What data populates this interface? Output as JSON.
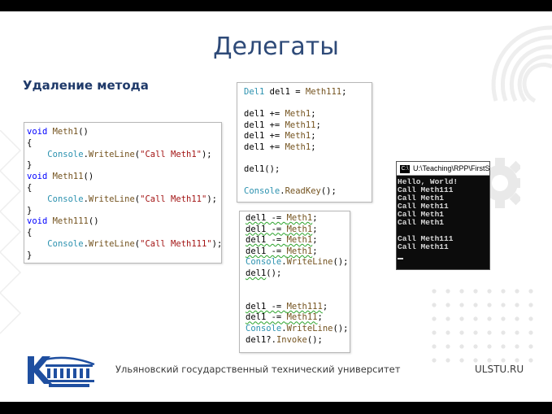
{
  "slide": {
    "title": "Делегаты",
    "subtitle": "Удаление метода"
  },
  "code_methods": {
    "lines": [
      [
        {
          "t": "void ",
          "c": "kw"
        },
        {
          "t": "Meth1",
          "c": "fn"
        },
        {
          "t": "()",
          "c": ""
        }
      ],
      [
        {
          "t": "{",
          "c": ""
        }
      ],
      [
        {
          "t": "    ",
          "c": ""
        },
        {
          "t": "Console",
          "c": "cls"
        },
        {
          "t": ".",
          "c": ""
        },
        {
          "t": "WriteLine",
          "c": "fn"
        },
        {
          "t": "(",
          "c": ""
        },
        {
          "t": "\"Call Meth1\"",
          "c": "str"
        },
        {
          "t": ");",
          "c": ""
        }
      ],
      [
        {
          "t": "}",
          "c": ""
        }
      ],
      [
        {
          "t": "void ",
          "c": "kw"
        },
        {
          "t": "Meth11",
          "c": "fn"
        },
        {
          "t": "()",
          "c": ""
        }
      ],
      [
        {
          "t": "{",
          "c": ""
        }
      ],
      [
        {
          "t": "    ",
          "c": ""
        },
        {
          "t": "Console",
          "c": "cls"
        },
        {
          "t": ".",
          "c": ""
        },
        {
          "t": "WriteLine",
          "c": "fn"
        },
        {
          "t": "(",
          "c": ""
        },
        {
          "t": "\"Call Meth11\"",
          "c": "str"
        },
        {
          "t": ");",
          "c": ""
        }
      ],
      [
        {
          "t": "}",
          "c": ""
        }
      ],
      [
        {
          "t": "void ",
          "c": "kw"
        },
        {
          "t": "Meth111",
          "c": "fn"
        },
        {
          "t": "()",
          "c": ""
        }
      ],
      [
        {
          "t": "{",
          "c": ""
        }
      ],
      [
        {
          "t": "    ",
          "c": ""
        },
        {
          "t": "Console",
          "c": "cls"
        },
        {
          "t": ".",
          "c": ""
        },
        {
          "t": "WriteLine",
          "c": "fn"
        },
        {
          "t": "(",
          "c": ""
        },
        {
          "t": "\"Call Meth111\"",
          "c": "str"
        },
        {
          "t": ");",
          "c": ""
        }
      ],
      [
        {
          "t": "}",
          "c": ""
        }
      ]
    ]
  },
  "code_add": {
    "lines": [
      [
        {
          "t": "Del1",
          "c": "cls"
        },
        {
          "t": " del1 = ",
          "c": ""
        },
        {
          "t": "Meth111",
          "c": "fn"
        },
        {
          "t": ";",
          "c": ""
        }
      ],
      [
        {
          "t": "",
          "c": ""
        }
      ],
      [
        {
          "t": "del1 += ",
          "c": ""
        },
        {
          "t": "Meth1",
          "c": "fn"
        },
        {
          "t": ";",
          "c": ""
        }
      ],
      [
        {
          "t": "del1 += ",
          "c": ""
        },
        {
          "t": "Meth11",
          "c": "fn"
        },
        {
          "t": ";",
          "c": ""
        }
      ],
      [
        {
          "t": "del1 += ",
          "c": ""
        },
        {
          "t": "Meth1",
          "c": "fn"
        },
        {
          "t": ";",
          "c": ""
        }
      ],
      [
        {
          "t": "del1 += ",
          "c": ""
        },
        {
          "t": "Meth1",
          "c": "fn"
        },
        {
          "t": ";",
          "c": ""
        }
      ],
      [
        {
          "t": "",
          "c": ""
        }
      ],
      [
        {
          "t": "del1",
          "c": ""
        },
        {
          "t": "();",
          "c": ""
        }
      ],
      [
        {
          "t": "",
          "c": ""
        }
      ],
      [
        {
          "t": "Console",
          "c": "cls"
        },
        {
          "t": ".",
          "c": ""
        },
        {
          "t": "ReadKey",
          "c": "fn"
        },
        {
          "t": "();",
          "c": ""
        }
      ]
    ]
  },
  "code_remove": {
    "lines": [
      [
        {
          "t": "del1 -= ",
          "c": "sq"
        },
        {
          "t": "Meth1",
          "c": "fn sq"
        },
        {
          "t": ";",
          "c": ""
        }
      ],
      [
        {
          "t": "del1 -= ",
          "c": "sq"
        },
        {
          "t": "Meth1",
          "c": "fn sq"
        },
        {
          "t": ";",
          "c": ""
        }
      ],
      [
        {
          "t": "del1 -= ",
          "c": "sq"
        },
        {
          "t": "Meth1",
          "c": "fn sq"
        },
        {
          "t": ";",
          "c": ""
        }
      ],
      [
        {
          "t": "del1 -= ",
          "c": "sq"
        },
        {
          "t": "Meth1",
          "c": "fn sq"
        },
        {
          "t": ";",
          "c": ""
        }
      ],
      [
        {
          "t": "Console",
          "c": "cls"
        },
        {
          "t": ".",
          "c": ""
        },
        {
          "t": "WriteLine",
          "c": "fn"
        },
        {
          "t": "();",
          "c": ""
        }
      ],
      [
        {
          "t": "del1",
          "c": "sq"
        },
        {
          "t": "();",
          "c": ""
        }
      ],
      [
        {
          "t": "",
          "c": ""
        }
      ],
      [
        {
          "t": "",
          "c": ""
        }
      ],
      [
        {
          "t": "del1 -= ",
          "c": "sq"
        },
        {
          "t": "Meth111",
          "c": "fn sq"
        },
        {
          "t": ";",
          "c": ""
        }
      ],
      [
        {
          "t": "del1 -= ",
          "c": "sq"
        },
        {
          "t": "Meth11",
          "c": "fn sq"
        },
        {
          "t": ";",
          "c": ""
        }
      ],
      [
        {
          "t": "Console",
          "c": "cls"
        },
        {
          "t": ".",
          "c": ""
        },
        {
          "t": "WriteLine",
          "c": "fn"
        },
        {
          "t": "();",
          "c": ""
        }
      ],
      [
        {
          "t": "del1",
          "c": ""
        },
        {
          "t": "?.",
          "c": ""
        },
        {
          "t": "Invoke",
          "c": "fn"
        },
        {
          "t": "();",
          "c": ""
        }
      ]
    ]
  },
  "console": {
    "title": "U:\\Teaching\\RPP\\FirstSe",
    "icon_label": "C:\\",
    "lines": [
      "Hello, World!",
      "Call Meth111",
      "Call Meth1",
      "Call Meth11",
      "Call Meth1",
      "Call Meth1",
      "",
      "Call Meth111",
      "Call Meth11"
    ]
  },
  "footer": {
    "university": "Ульяновский государственный технический университет",
    "url": "ULSTU.RU"
  },
  "colors": {
    "title": "#2e4a78",
    "accent": "#1f3a6a",
    "keyword": "#0000ff",
    "method": "#74531f",
    "class": "#2b91af",
    "string": "#a31515"
  }
}
